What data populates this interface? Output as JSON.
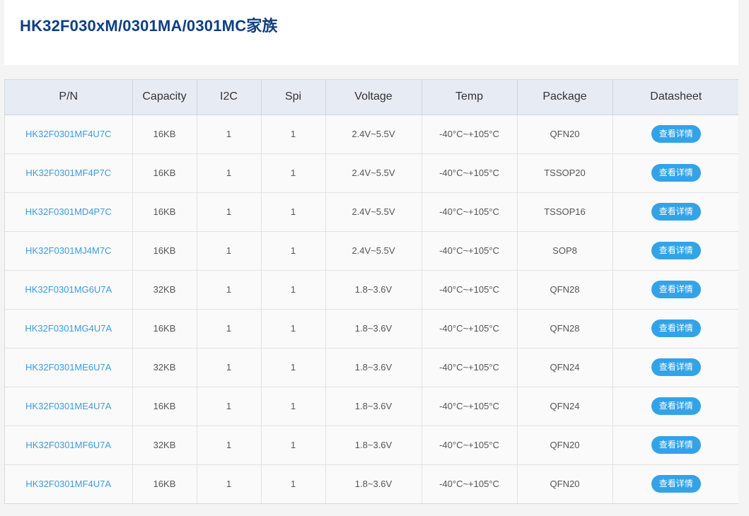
{
  "page_title": "HK32F030xM/0301MA/0301MC家族",
  "columns": [
    "P/N",
    "Capacity",
    "I2C",
    "Spi",
    "Voltage",
    "Temp",
    "Package",
    "Datasheet"
  ],
  "button_label": "查看详情",
  "colors": {
    "title": "#0f3f80",
    "link": "#3b9be0",
    "button": "#33a3e8",
    "header_bg": "#e7ebf4"
  },
  "rows": [
    {
      "pn": "HK32F0301MF4U7C",
      "capacity": "16KB",
      "i2c": "1",
      "spi": "1",
      "voltage": "2.4V~5.5V",
      "temp": "-40°C~+105°C",
      "package": "QFN20",
      "datasheet": "查看详情"
    },
    {
      "pn": "HK32F0301MF4P7C",
      "capacity": "16KB",
      "i2c": "1",
      "spi": "1",
      "voltage": "2.4V~5.5V",
      "temp": "-40°C~+105°C",
      "package": "TSSOP20",
      "datasheet": "查看详情"
    },
    {
      "pn": "HK32F0301MD4P7C",
      "capacity": "16KB",
      "i2c": "1",
      "spi": "1",
      "voltage": "2.4V~5.5V",
      "temp": "-40°C~+105°C",
      "package": "TSSOP16",
      "datasheet": "查看详情"
    },
    {
      "pn": "HK32F0301MJ4M7C",
      "capacity": "16KB",
      "i2c": "1",
      "spi": "1",
      "voltage": "2.4V~5.5V",
      "temp": "-40°C~+105°C",
      "package": "SOP8",
      "datasheet": "查看详情"
    },
    {
      "pn": "HK32F0301MG6U7A",
      "capacity": "32KB",
      "i2c": "1",
      "spi": "1",
      "voltage": "1.8~3.6V",
      "temp": "-40°C~+105°C",
      "package": "QFN28",
      "datasheet": "查看详情"
    },
    {
      "pn": "HK32F0301MG4U7A",
      "capacity": "16KB",
      "i2c": "1",
      "spi": "1",
      "voltage": "1.8~3.6V",
      "temp": "-40°C~+105°C",
      "package": "QFN28",
      "datasheet": "查看详情"
    },
    {
      "pn": "HK32F0301ME6U7A",
      "capacity": "32KB",
      "i2c": "1",
      "spi": "1",
      "voltage": "1.8~3.6V",
      "temp": "-40°C~+105°C",
      "package": "QFN24",
      "datasheet": "查看详情"
    },
    {
      "pn": "HK32F0301ME4U7A",
      "capacity": "16KB",
      "i2c": "1",
      "spi": "1",
      "voltage": "1.8~3.6V",
      "temp": "-40°C~+105°C",
      "package": "QFN24",
      "datasheet": "查看详情"
    },
    {
      "pn": "HK32F0301MF6U7A",
      "capacity": "32KB",
      "i2c": "1",
      "spi": "1",
      "voltage": "1.8~3.6V",
      "temp": "-40°C~+105°C",
      "package": "QFN20",
      "datasheet": "查看详情"
    },
    {
      "pn": "HK32F0301MF4U7A",
      "capacity": "16KB",
      "i2c": "1",
      "spi": "1",
      "voltage": "1.8~3.6V",
      "temp": "-40°C~+105°C",
      "package": "QFN20",
      "datasheet": "查看详情"
    }
  ]
}
